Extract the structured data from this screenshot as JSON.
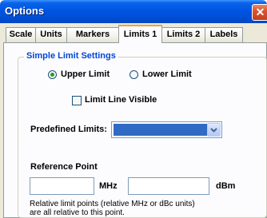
{
  "window": {
    "title": "Options",
    "close_glyph": "✕"
  },
  "tabs": [
    {
      "label": "Scale",
      "active": false
    },
    {
      "label": "Units",
      "active": false
    },
    {
      "label": "Markers",
      "active": false
    },
    {
      "label": "Limits 1",
      "active": true
    },
    {
      "label": "Limits 2",
      "active": false
    },
    {
      "label": "Labels",
      "active": false
    }
  ],
  "simple_limits": {
    "group_title": "Simple Limit Settings",
    "upper_label": "Upper Limit",
    "lower_label": "Lower Limit",
    "selected": "upper",
    "limit_line_visible_label": "Limit Line Visible",
    "limit_line_visible": false
  },
  "predefined": {
    "label": "Predefined Limits:",
    "value": ""
  },
  "reference_point": {
    "label": "Reference Point",
    "freq_value": "",
    "freq_unit": "MHz",
    "level_value": "",
    "level_unit": "dBm",
    "note_line1": "Relative limit points (relative MHz or dBc units)",
    "note_line2": "are all relative to this point."
  },
  "colors": {
    "accent": "#0046d5",
    "title_bar": "#0054e3",
    "selection": "#316ac5",
    "radio_dot": "#21a121"
  }
}
